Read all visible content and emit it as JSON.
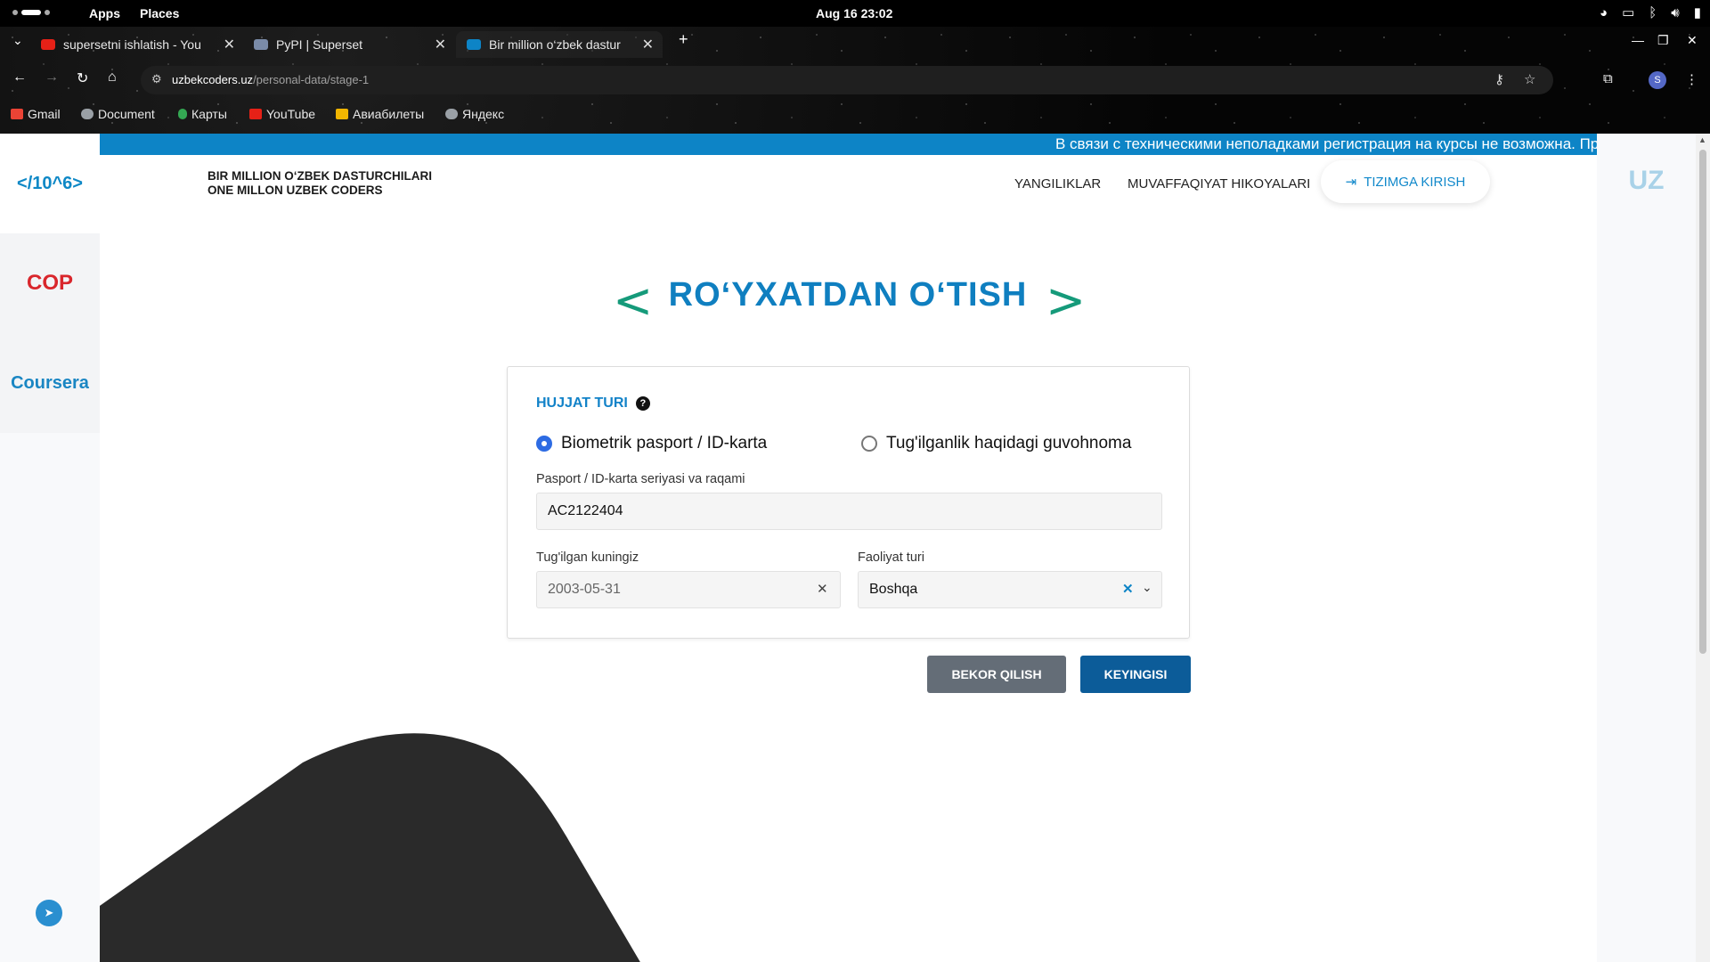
{
  "os": {
    "apps": "Apps",
    "places": "Places",
    "clock": "Aug 16  23:02"
  },
  "browser": {
    "tabs": [
      {
        "title": "supersetni ishlatish - You",
        "icon_color": "#e62117"
      },
      {
        "title": "PyPI | Superset",
        "icon_color": "#7a8ba8"
      },
      {
        "title": "Bir million o‘zbek dastur",
        "icon_color": "#0d84c6"
      }
    ],
    "url_host": "uzbekcoders.uz",
    "url_path": "/personal-data/stage-1",
    "profile_initial": "S",
    "bookmarks": [
      {
        "label": "Gmail",
        "icon_color": "#ea4335"
      },
      {
        "label": "Document",
        "icon_color": "#9aa0a6"
      },
      {
        "label": "Карты",
        "icon_color": "#34a853"
      },
      {
        "label": "YouTube",
        "icon_color": "#e62117"
      },
      {
        "label": "Авиабилеты",
        "icon_color": "#f2b600"
      },
      {
        "label": "Яндекс",
        "icon_color": "#9aa0a6"
      }
    ]
  },
  "rail": {
    "logo": "</10^6>",
    "cop": "COP",
    "coursera": "Coursera"
  },
  "ticker": "В связи с техническими неполадками регистрация на курсы не возможна. Проблема",
  "header": {
    "brand_line1": "BIR MILLION O‘ZBEK DASTURCHILARI",
    "brand_line2": "ONE MILLON UZBEK CODERS",
    "nav_news": "YANGILIKLAR",
    "nav_stories": "MUVAFFAQIYAT HIKOYALARI",
    "login": "TIZIMGA KIRISH",
    "lang": "UZ"
  },
  "page_title": "RO‘YXATDAN O‘TISH",
  "form": {
    "section_title": "HUJJAT TURI",
    "radio_passport": "Biometrik pasport / ID-karta",
    "radio_birth": "Tug'ilganlik haqidagi guvohnoma",
    "selected": "passport",
    "passport_label": "Pasport / ID-karta seriyasi va raqami",
    "passport_value": "AC2122404",
    "birthday_label": "Tug'ilgan kuningiz",
    "birthday_value": "2003-05-31",
    "activity_label": "Faoliyat turi",
    "activity_value": "Boshqa"
  },
  "buttons": {
    "cancel": "BEKOR QILISH",
    "next": "KEYINGISI"
  },
  "colors": {
    "accent": "#0f7fc0",
    "chevron": "#159a7a",
    "cop_red": "#d9262c",
    "next_button": "#0c5c99",
    "cancel_button": "#646d77"
  }
}
